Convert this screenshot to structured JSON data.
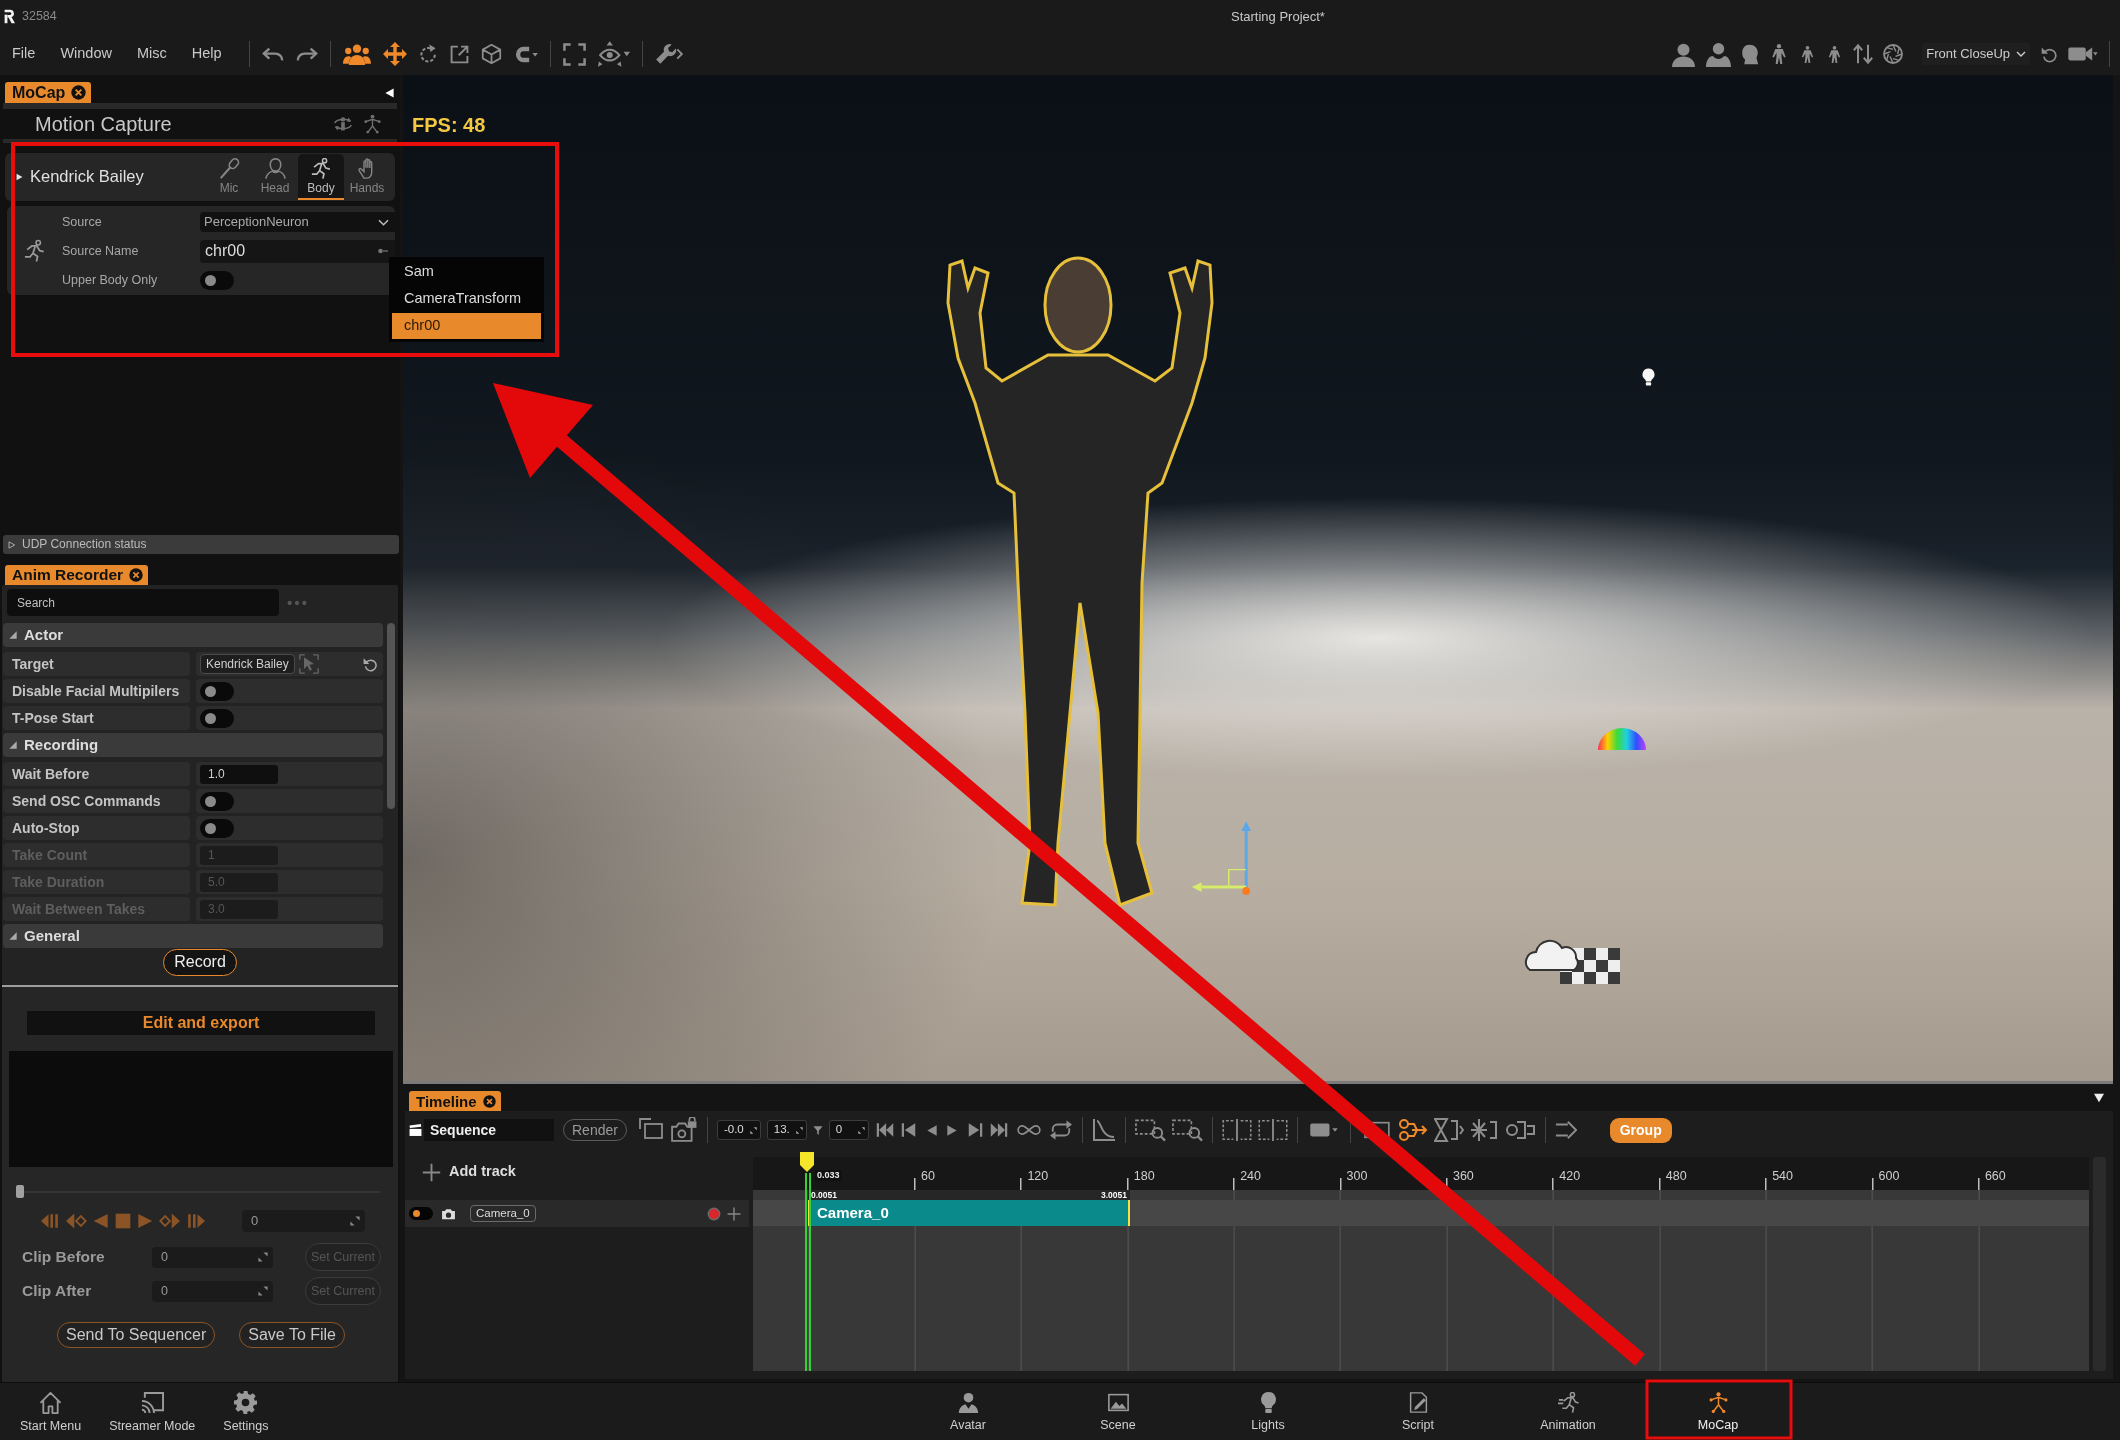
{
  "title_bar": {
    "app_id": "32584",
    "project": "Starting Project*"
  },
  "menu": [
    "File",
    "Window",
    "Misc",
    "Help"
  ],
  "view_preset": {
    "value": "Front CloseUp"
  },
  "mocap_panel": {
    "tab": "MoCap",
    "title": "Motion Capture",
    "actor": {
      "name": "Kendrick Bailey",
      "expanded": false
    },
    "modes": [
      {
        "label": "Mic",
        "selected": false
      },
      {
        "label": "Head",
        "selected": false
      },
      {
        "label": "Body",
        "selected": true
      },
      {
        "label": "Hands",
        "selected": false
      }
    ],
    "fields": [
      {
        "kind": "select",
        "label": "Source",
        "value": "PerceptionNeuron"
      },
      {
        "kind": "text",
        "label": "Source Name",
        "value": "chr00"
      },
      {
        "kind": "toggle",
        "label": "Upper Body Only",
        "on": false
      }
    ],
    "dropdown": [
      {
        "label": "Sam",
        "selected": false
      },
      {
        "label": "CameraTransform",
        "selected": false
      },
      {
        "label": "chr00",
        "selected": true
      }
    ],
    "udp_status": {
      "label": "UDP Connection status",
      "expanded": false
    }
  },
  "viewport": {
    "fps": "FPS: 48"
  },
  "anim_recorder": {
    "tab": "Anim Recorder",
    "search": {
      "placeholder": "Search"
    },
    "sections": [
      {
        "title": "Actor",
        "expanded": true,
        "rows": [
          {
            "kind": "target",
            "label": "Target",
            "value": "Kendrick Bailey",
            "disabled": false
          },
          {
            "kind": "toggle",
            "label": "Disable Facial Multipilers",
            "on": false,
            "disabled": false
          },
          {
            "kind": "toggle",
            "label": "T-Pose Start",
            "on": false,
            "disabled": false
          }
        ]
      },
      {
        "title": "Recording",
        "expanded": true,
        "rows": [
          {
            "kind": "number",
            "label": "Wait Before",
            "value": "1.0",
            "disabled": false
          },
          {
            "kind": "toggle",
            "label": "Send OSC Commands",
            "on": false,
            "disabled": false
          },
          {
            "kind": "toggle",
            "label": "Auto-Stop",
            "on": false,
            "disabled": false
          },
          {
            "kind": "number",
            "label": "Take Count",
            "value": "1",
            "disabled": true
          },
          {
            "kind": "number",
            "label": "Take Duration",
            "value": "5.0",
            "disabled": true
          },
          {
            "kind": "number",
            "label": "Wait Between Takes",
            "value": "3.0",
            "disabled": true
          }
        ]
      },
      {
        "title": "General",
        "expanded": true
      }
    ],
    "record_button": "Record"
  },
  "edit_export": {
    "title": "Edit and export",
    "scrub": {
      "level": 0
    },
    "frame": "0",
    "clips": [
      {
        "label": "Clip Before",
        "value": "0",
        "button": "Set Current",
        "disabled": true
      },
      {
        "label": "Clip After",
        "value": "0",
        "button": "Set Current",
        "disabled": true
      }
    ],
    "buttons": [
      "Send To Sequencer",
      "Save To File"
    ]
  },
  "timeline": {
    "tab": "Timeline",
    "sequence": "Sequence",
    "render_button": "Render",
    "range_start": "-0.0",
    "range_end": "13.",
    "filter_value": "0",
    "group_button": "Group",
    "add_track": "Add track",
    "tracks": [
      {
        "name": "Camera_0",
        "on": false
      }
    ],
    "playhead": "0.033",
    "ruler": [
      "60",
      "120",
      "180",
      "240",
      "300",
      "360",
      "420",
      "480",
      "540",
      "600",
      "660"
    ],
    "clip": {
      "label": "Camera_0",
      "start": "0.0051",
      "end": "3.0051"
    }
  },
  "bottom_nav": {
    "left": [
      "Start Menu",
      "Streamer Mode",
      "Settings"
    ],
    "center": [
      {
        "label": "Avatar",
        "selected": false
      },
      {
        "label": "Scene",
        "selected": false
      },
      {
        "label": "Lights",
        "selected": false
      },
      {
        "label": "Script",
        "selected": false
      },
      {
        "label": "Animation",
        "selected": false
      },
      {
        "label": "MoCap",
        "selected": true
      }
    ]
  }
}
